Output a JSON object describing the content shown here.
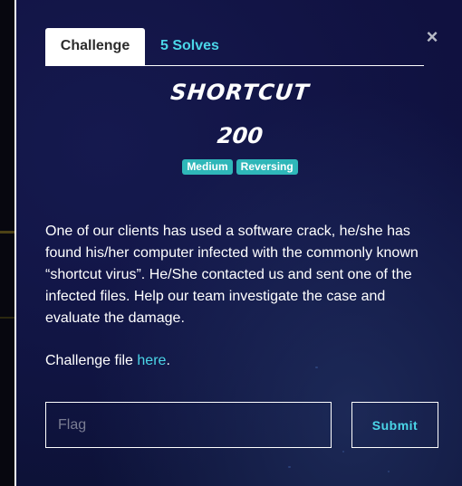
{
  "modal": {
    "close_symbol": "×",
    "tabs": [
      {
        "label": "Challenge",
        "active": true
      },
      {
        "label": "5 Solves",
        "active": false
      }
    ],
    "title": "shortcut",
    "points": "200",
    "tags": [
      "Medium",
      "Reversing"
    ],
    "description": "One of our clients has used a software crack, he/she has found his/her computer infected with the commonly known “shortcut virus”. He/She contacted us and sent one of the infected files. Help our team investigate the case and evaluate the damage.",
    "challenge_file": {
      "prefix": "Challenge file ",
      "link_label": "here",
      "suffix": "."
    },
    "flag_input": {
      "placeholder": "Flag",
      "value": ""
    },
    "submit_label": "Submit"
  },
  "colors": {
    "accent": "#4bd6e8",
    "tag_bg": "#2fb7b9",
    "modal_bg": "#101140"
  },
  "icons": {
    "close": "close-icon"
  }
}
